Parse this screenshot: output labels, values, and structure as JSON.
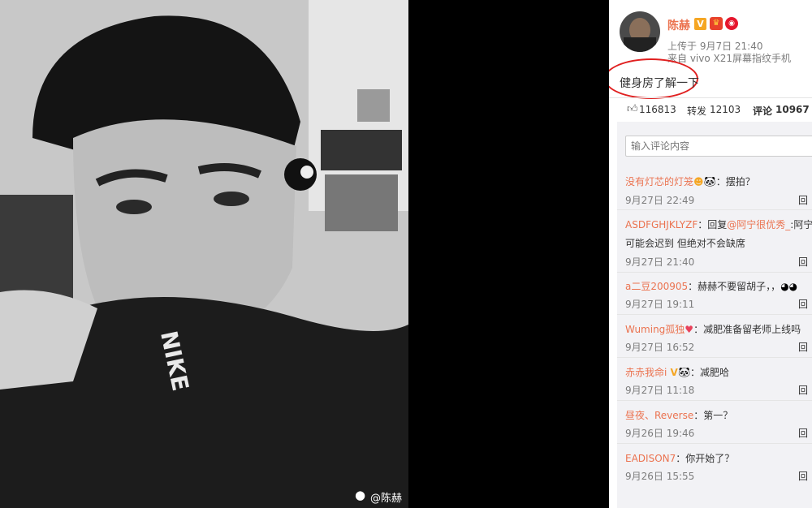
{
  "photo": {
    "watermark": "@陈赫"
  },
  "post": {
    "author": "陈赫",
    "time_label": "上传于 9月7日 21:40",
    "source_label": "来自 vivo X21屏幕指纹手机",
    "text": "健身房了解一下"
  },
  "stats": {
    "likes": "116813",
    "repost_label": "转发",
    "repost_count": "12103",
    "comment_label": "评论",
    "comment_count": "10967"
  },
  "comment_input": {
    "placeholder": "输入评论内容"
  },
  "comments": [
    {
      "user": "没有灯芯的灯笼",
      "text": "：摆拍？",
      "date": "9月27日 22:49",
      "reply": "回"
    },
    {
      "user": "ASDFGHJKLYZF",
      "text_prefix": "：回复",
      "mention": "@阿宁很优秀_",
      "text_suffix": ":阿宁",
      "line2": "可能会迟到  但绝对不会缺席",
      "date": "9月27日 21:40",
      "reply": "回"
    },
    {
      "user": "a二豆200905",
      "text": "：赫赫不要留胡子，，",
      "date": "9月27日 19:11",
      "reply": "回"
    },
    {
      "user": "Wuming孤独",
      "text": "：减肥准备留老师上线吗",
      "date": "9月27日 16:52",
      "reply": "回"
    },
    {
      "user": "赤赤我命i",
      "text": "：减肥哈",
      "date": "9月27日 11:18",
      "reply": "回"
    },
    {
      "user": "昼夜、Reverse",
      "text": "：第一？",
      "date": "9月26日 19:46",
      "reply": "回"
    },
    {
      "user": "EADISON7",
      "text": "：你开始了？",
      "date": "9月26日 15:55",
      "reply": "回"
    }
  ],
  "colors": {
    "link": "#eb7350",
    "muted": "#7c7c7c",
    "circle": "#e02020",
    "vip": "#f5a623"
  }
}
